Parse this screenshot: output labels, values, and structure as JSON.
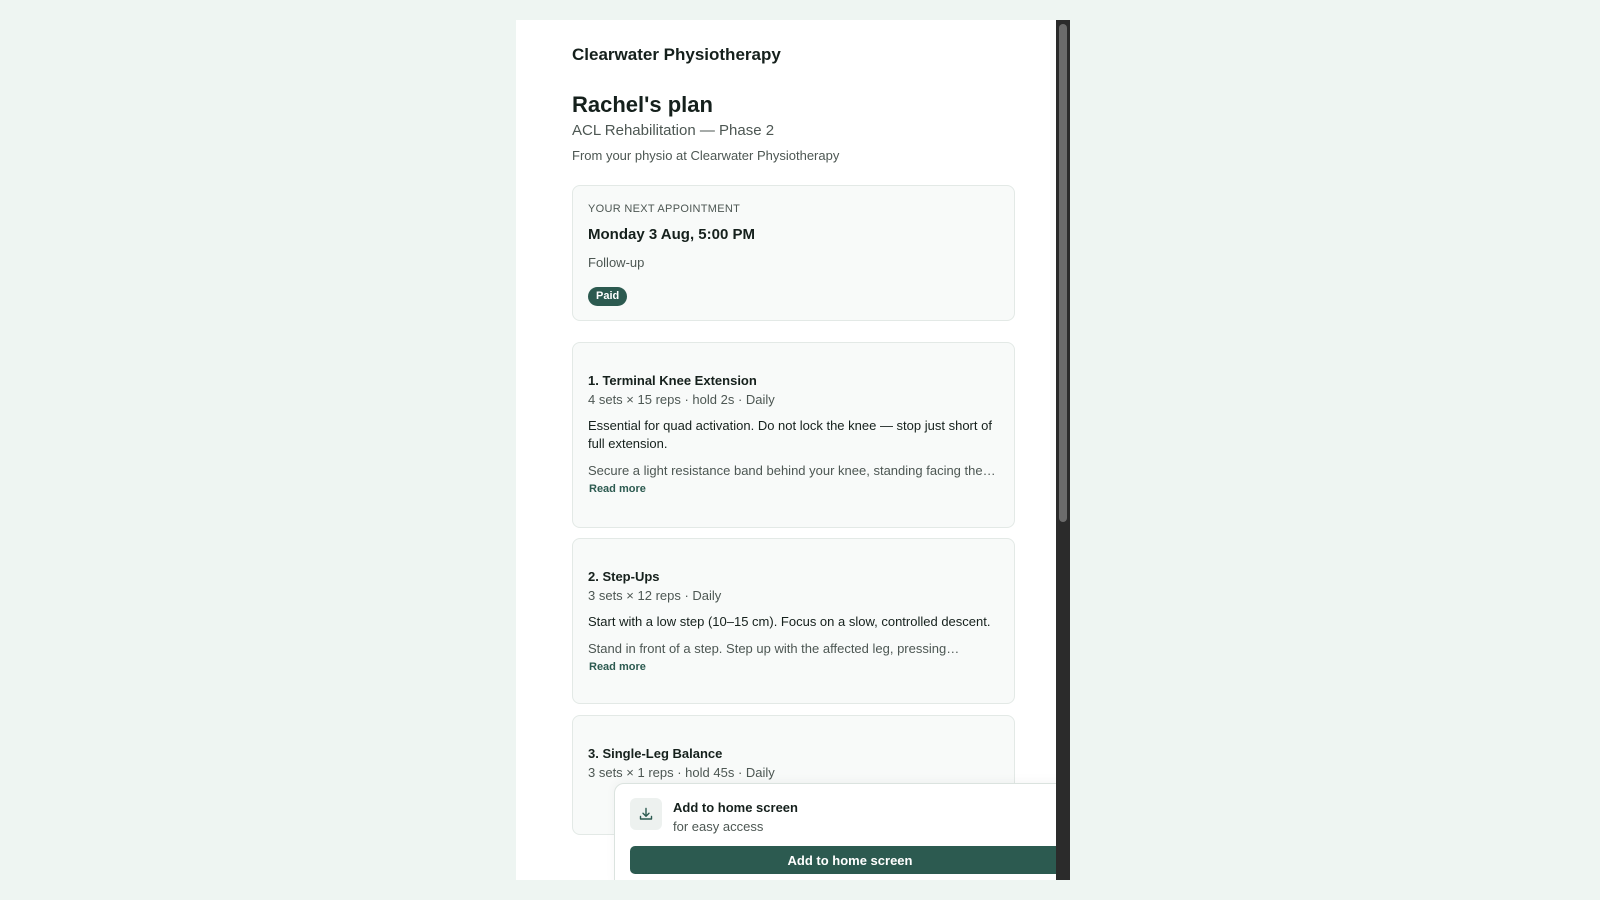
{
  "header": {
    "clinic_name": "Clearwater Physiotherapy",
    "plan_title": "Rachel's plan",
    "plan_subtitle": "ACL Rehabilitation — Phase 2",
    "plan_from": "From your physio at Clearwater Physiotherapy"
  },
  "appointment": {
    "label": "Your next appointment",
    "date": "Monday 3 Aug, 5:00 PM",
    "type": "Follow-up",
    "status": "Paid"
  },
  "exercises": [
    {
      "title": "1. Terminal Knee Extension",
      "meta": "4 sets × 15 reps · hold 2s · Daily",
      "note": "Essential for quad activation. Do not lock the knee — stop just short of full extension.",
      "description": "Secure a light resistance band behind your knee, standing facing the…",
      "read_more": "Read more"
    },
    {
      "title": "2. Step-Ups",
      "meta": "3 sets × 12 reps · Daily",
      "note": "Start with a low step (10–15 cm). Focus on a slow, controlled descent.",
      "description": "Stand in front of a step. Step up with the affected leg, pressing…",
      "read_more": "Read more"
    },
    {
      "title": "3. Single-Leg Balance",
      "meta": "3 sets × 1 reps · hold 45s · Daily"
    }
  ],
  "install_prompt": {
    "title": "Add to home screen",
    "subtitle": "for easy access",
    "button_label": "Add to home screen",
    "icon": "download-icon",
    "close_icon": "close-icon"
  },
  "colors": {
    "accent": "#2c5a50",
    "page_background": "#eef5f2",
    "card_background": "#f8faf9"
  }
}
